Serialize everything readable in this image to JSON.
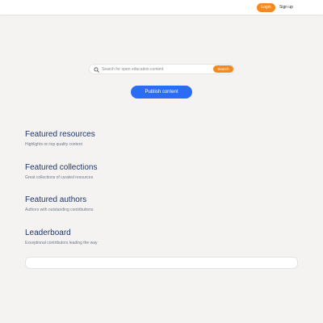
{
  "header": {
    "login_label": "Login",
    "signup_label": "Sign up"
  },
  "search": {
    "placeholder": "Search for open education content",
    "button_label": "Search",
    "icon": "search-icon"
  },
  "publish_label": "Publish content",
  "sections": [
    {
      "title": "Featured resources",
      "subtitle": "Highlights on top quality content"
    },
    {
      "title": "Featured collections",
      "subtitle": "Great collections of curated resources"
    },
    {
      "title": "Featured authors",
      "subtitle": "Authors with outstanding contributions"
    },
    {
      "title": "Leaderboard",
      "subtitle": "Exceptional contributors leading the way"
    }
  ],
  "colors": {
    "accent": "#f5891f",
    "primary": "#2a6cf5",
    "heading": "#1f3566",
    "background": "#f4f3f1"
  }
}
